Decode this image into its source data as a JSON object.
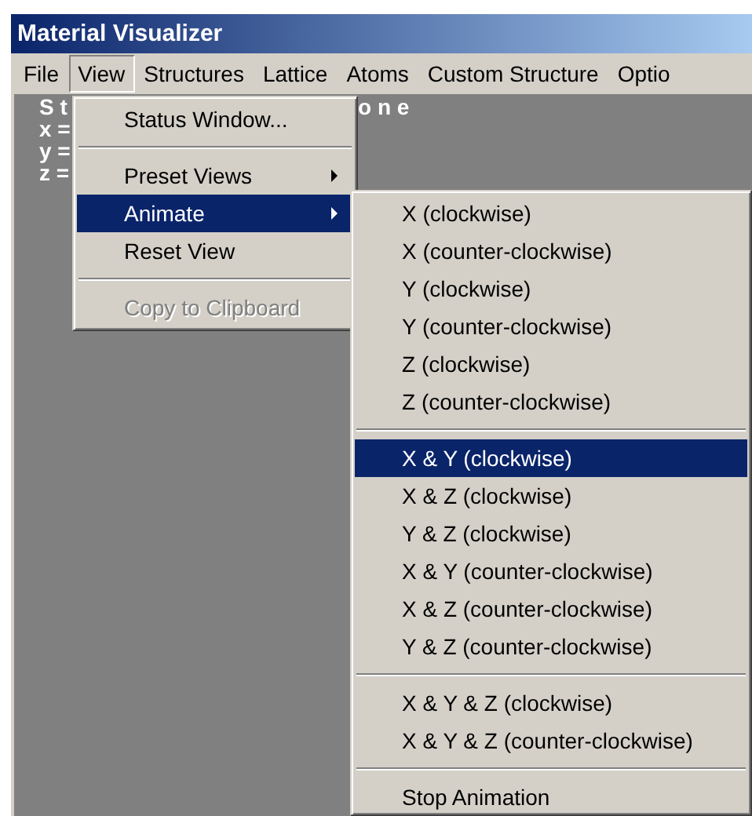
{
  "window": {
    "title": "Material Visualizer"
  },
  "menubar": [
    {
      "label": "File",
      "selected": false
    },
    {
      "label": "View",
      "selected": true
    },
    {
      "label": "Structures",
      "selected": false
    },
    {
      "label": "Lattice",
      "selected": false
    },
    {
      "label": "Atoms",
      "selected": false
    },
    {
      "label": "Custom Structure",
      "selected": false
    },
    {
      "label": "Optio",
      "selected": false
    }
  ],
  "canvas": {
    "status_left": "S t",
    "status_right": "o n e",
    "coords": [
      "x =",
      "y =",
      "z ="
    ]
  },
  "view_menu": {
    "groups": [
      [
        {
          "label": "Status Window...",
          "selected": false,
          "disabled": false,
          "submenu": false
        }
      ],
      [
        {
          "label": "Preset Views",
          "selected": false,
          "disabled": false,
          "submenu": true
        },
        {
          "label": "Animate",
          "selected": true,
          "disabled": false,
          "submenu": true
        },
        {
          "label": "Reset View",
          "selected": false,
          "disabled": false,
          "submenu": false
        }
      ],
      [
        {
          "label": "Copy to Clipboard",
          "selected": false,
          "disabled": true,
          "submenu": false
        }
      ]
    ]
  },
  "animate_menu": {
    "groups": [
      [
        {
          "label": "X (clockwise)",
          "selected": false
        },
        {
          "label": "X (counter-clockwise)",
          "selected": false
        },
        {
          "label": "Y (clockwise)",
          "selected": false
        },
        {
          "label": "Y (counter-clockwise)",
          "selected": false
        },
        {
          "label": "Z (clockwise)",
          "selected": false
        },
        {
          "label": "Z (counter-clockwise)",
          "selected": false
        }
      ],
      [
        {
          "label": "X & Y (clockwise)",
          "selected": true
        },
        {
          "label": "X & Z (clockwise)",
          "selected": false
        },
        {
          "label": "Y & Z (clockwise)",
          "selected": false
        },
        {
          "label": "X & Y (counter-clockwise)",
          "selected": false
        },
        {
          "label": "X & Z (counter-clockwise)",
          "selected": false
        },
        {
          "label": "Y & Z (counter-clockwise)",
          "selected": false
        }
      ],
      [
        {
          "label": "X & Y & Z (clockwise)",
          "selected": false
        },
        {
          "label": "X & Y & Z (counter-clockwise)",
          "selected": false
        }
      ],
      [
        {
          "label": "Stop Animation",
          "selected": false
        }
      ]
    ]
  }
}
